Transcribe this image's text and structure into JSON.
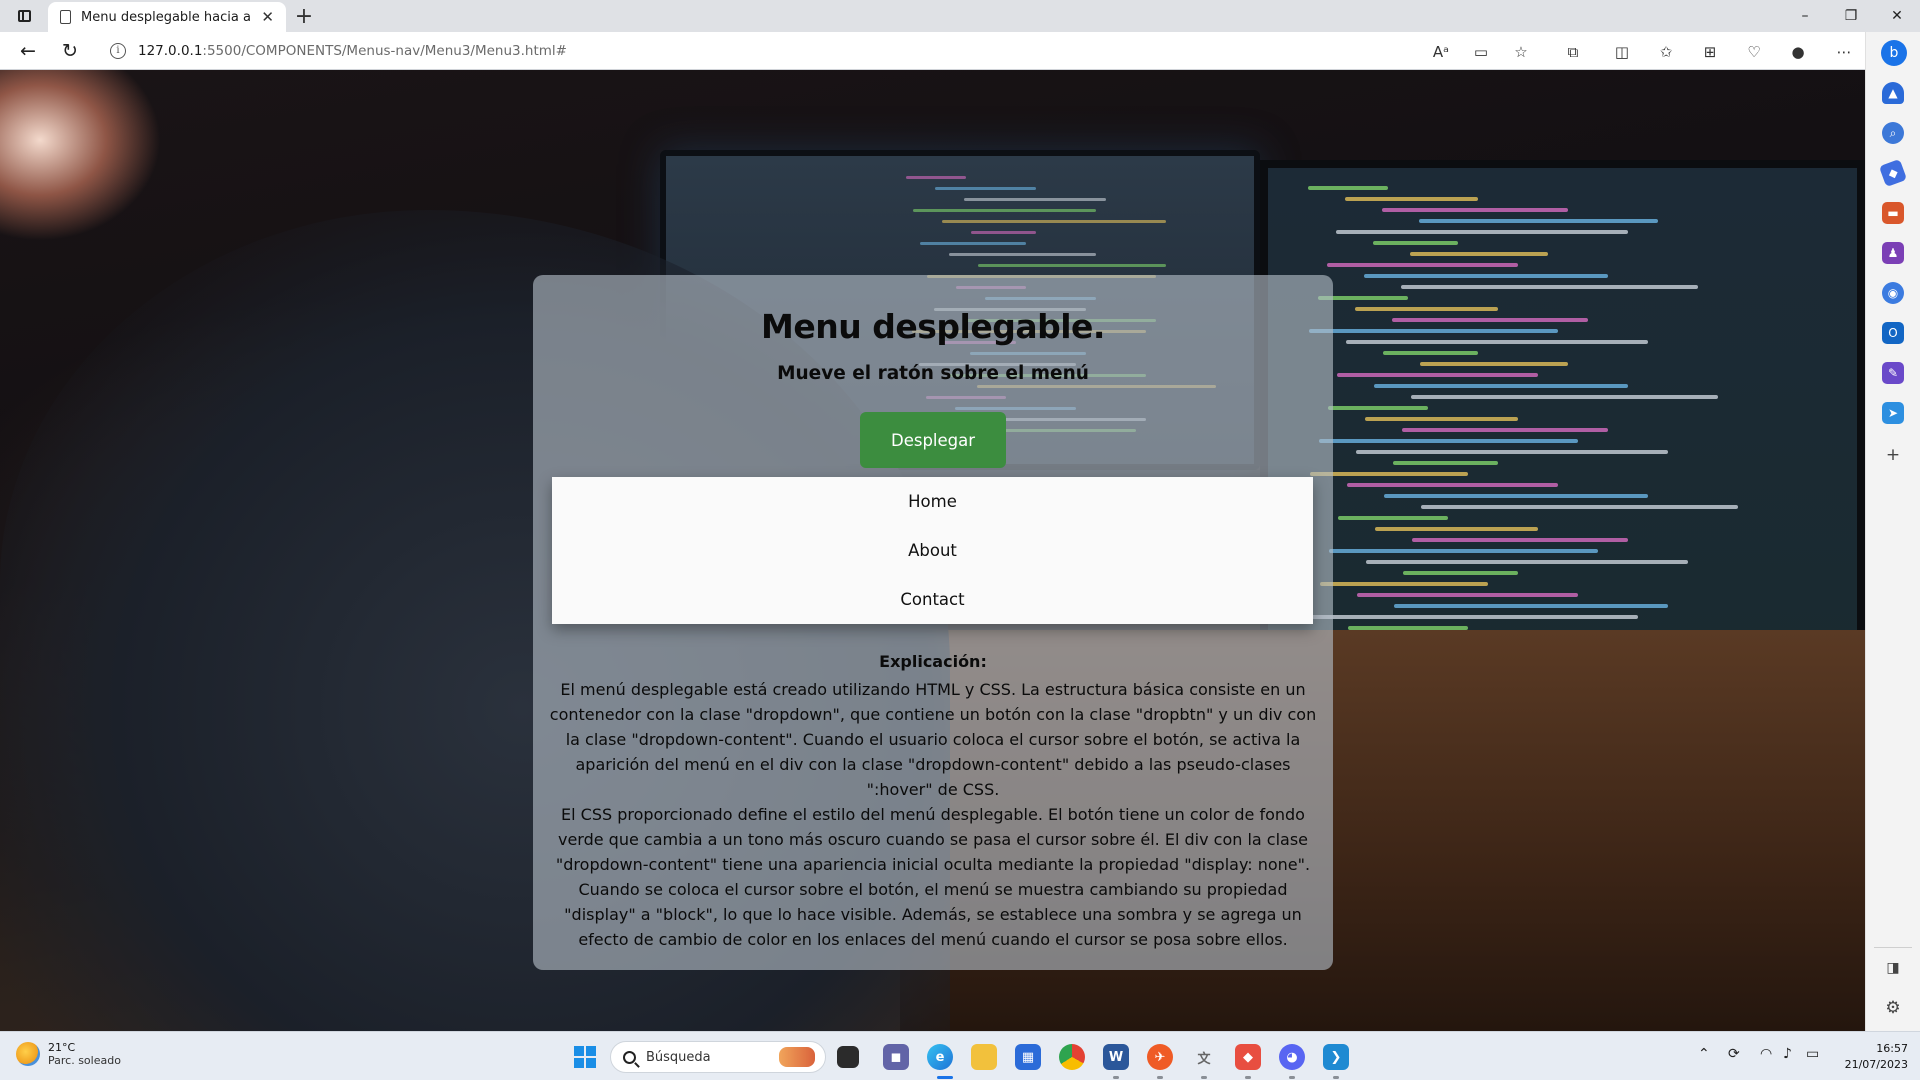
{
  "browser": {
    "tab_title": "Menu desplegable hacia abajo",
    "tab_close": "✕",
    "new_tab": "+",
    "url_host": "127.0.0.1",
    "url_rest": ":5500/COMPONENTS/Menus-nav/Menu3/Menu3.html#",
    "window_controls": {
      "minimize": "–",
      "restore": "❐",
      "close": "✕"
    },
    "nav": {
      "back": "←",
      "reload": "↻"
    },
    "toolbar_icons": [
      "read-aloud-icon",
      "immersive-reader-icon",
      "favorite-star-icon",
      "extensions-icon",
      "split-screen-icon",
      "favorites-icon",
      "collections-icon",
      "browser-essentials-icon",
      "profile-icon",
      "more-icon"
    ]
  },
  "sidebar_icons": [
    "bing-copilot-icon",
    "notifications-icon",
    "search-icon",
    "shopping-icon",
    "tools-icon",
    "games-icon",
    "microsoft-365-icon",
    "outlook-icon",
    "designer-icon",
    "drop-icon",
    "add-icon",
    "hide-sidebar-icon",
    "settings-icon"
  ],
  "card": {
    "title": "Menu desplegable.",
    "subtitle": "Mueve el ratón sobre el menú",
    "button_label": "Desplegar",
    "button_color": "#3c8d3f",
    "menu_items": [
      "Home",
      "About",
      "Contact"
    ],
    "explanation_heading": "Explicación:",
    "explanation_p1": "El menú desplegable está creado utilizando HTML y CSS. La estructura básica consiste en un contenedor con la clase \"dropdown\", que contiene un botón con la clase \"dropbtn\" y un div con la clase \"dropdown-content\". Cuando el usuario coloca el cursor sobre el botón, se activa la aparición del menú en el div con la clase \"dropdown-content\" debido a las pseudo-clases \":hover\" de CSS.",
    "explanation_p2": "El CSS proporcionado define el estilo del menú desplegable. El botón tiene un color de fondo verde que cambia a un tono más oscuro cuando se pasa el cursor sobre él. El div con la clase \"dropdown-content\" tiene una apariencia inicial oculta mediante la propiedad \"display: none\". Cuando se coloca el cursor sobre el botón, el menú se muestra cambiando su propiedad \"display\" a \"block\", lo que lo hace visible. Además, se establece una sombra y se agrega un efecto de cambio de color en los enlaces del menú cuando el cursor se posa sobre ellos."
  },
  "taskbar": {
    "weather_temp": "21°C",
    "weather_desc": "Parc. soleado",
    "search_placeholder": "Búsqueda",
    "apps": [
      "start-icon",
      "task-view-icon",
      "teams-chat-icon",
      "edge-icon",
      "file-explorer-icon",
      "store-icon",
      "chrome-icon",
      "word-icon",
      "postman-icon",
      "translator-icon",
      "git-icon",
      "discord-icon",
      "vscode-icon"
    ],
    "time": "16:57",
    "date": "21/07/2023"
  }
}
